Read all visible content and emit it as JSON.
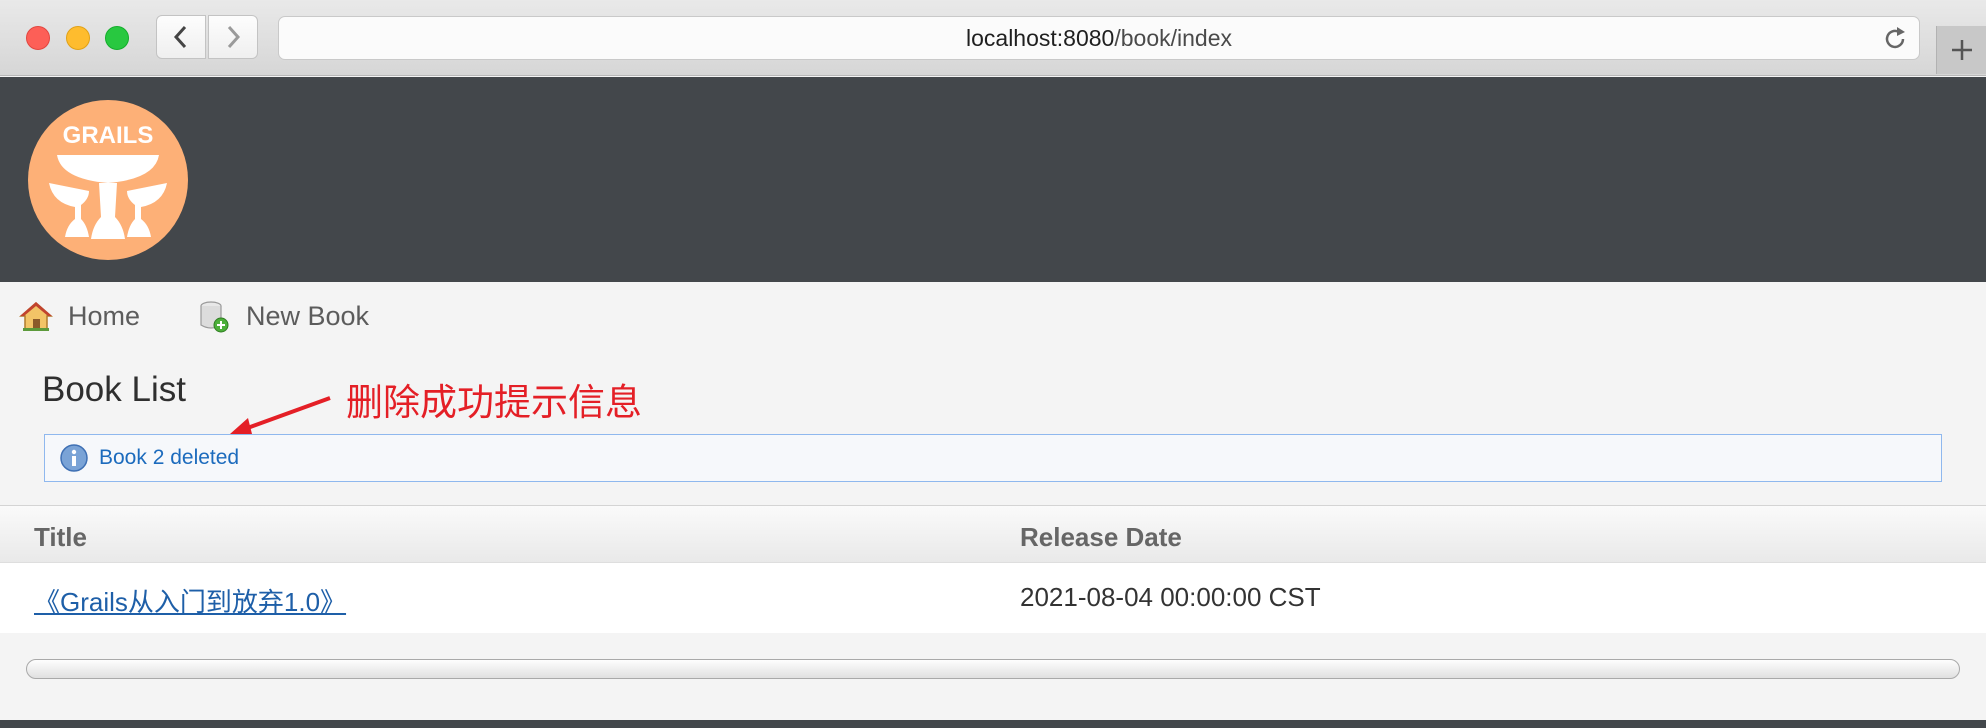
{
  "browser": {
    "url_host": "localhost:8080",
    "url_path": "/book/index",
    "back_icon": "chevron-left-icon",
    "forward_icon": "chevron-right-icon",
    "reload_icon": "reload-icon",
    "new_tab_icon": "plus-icon"
  },
  "header": {
    "logo_text": "GRAILS",
    "logo_color": "#fdb077",
    "background": "#43474b"
  },
  "nav": {
    "items": [
      {
        "label": "Home",
        "icon": "home-icon"
      },
      {
        "label": "New Book",
        "icon": "database-add-icon"
      }
    ]
  },
  "page": {
    "title": "Book List",
    "annotation": "删除成功提示信息",
    "annotation_color": "#e41f26"
  },
  "message": {
    "text": "Book 2 deleted",
    "icon": "info-icon"
  },
  "table": {
    "columns": [
      "Title",
      "Release Date"
    ],
    "rows": [
      {
        "title": "《Grails从入门到放弃1.0》",
        "release_date": "2021-08-04 00:00:00 CST"
      }
    ]
  }
}
